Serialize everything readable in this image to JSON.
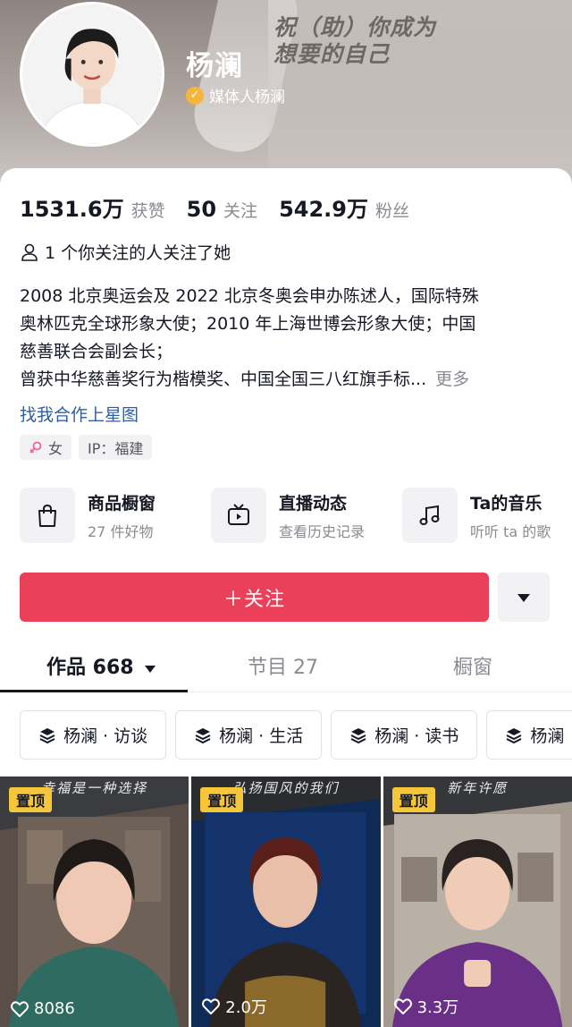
{
  "profile": {
    "name": "杨澜",
    "verified_label": "媒体人杨澜",
    "banner_slogan_line1": "祝（助）你成为",
    "banner_slogan_line2": "想要的自己"
  },
  "stats": [
    {
      "num": "1531.6万",
      "label": "获赞"
    },
    {
      "num": "50",
      "label": "关注"
    },
    {
      "num": "542.9万",
      "label": "粉丝"
    }
  ],
  "mutual_text": "1 个你关注的人关注了她",
  "bio": {
    "line1": "2008 北京奥运会及 2022 北京冬奥会申办陈述人，国际特殊",
    "line2": "奥林匹克全球形象大使；2010 年上海世博会形象大使；中国",
    "line3": "慈善联合会副会长；",
    "line4": "曾获中华慈善奖行为楷模奖、中国全国三八红旗手标...",
    "more": "更多",
    "link": "找我合作上星图"
  },
  "tags": {
    "gender": "女",
    "ip": "IP：福建"
  },
  "services": [
    {
      "title": "商品橱窗",
      "sub": "27 件好物",
      "icon": "shopping-bag-icon"
    },
    {
      "title": "直播动态",
      "sub": "查看历史记录",
      "icon": "tv-icon"
    },
    {
      "title": "Ta的音乐",
      "sub": "听听 ta 的歌",
      "icon": "music-note-icon"
    }
  ],
  "follow_button": "＋关注",
  "tabs": {
    "works": "作品 668",
    "programs": "节目 27",
    "showcase": "橱窗"
  },
  "collections": [
    "杨澜 · 访谈",
    "杨澜 · 生活",
    "杨澜 · 读书",
    "杨澜"
  ],
  "videos": [
    {
      "pin": "置顶",
      "caption": "幸福是一种选择",
      "likes": "8086"
    },
    {
      "pin": "置顶",
      "caption": "弘扬国风的我们",
      "likes": "2.0万"
    },
    {
      "pin": "置顶",
      "caption": "新年许愿",
      "likes": "3.3万"
    }
  ],
  "colors": {
    "accent": "#ea4059",
    "verify": "#f6b53a",
    "pin": "#f6c63a",
    "link": "#315ea0"
  }
}
